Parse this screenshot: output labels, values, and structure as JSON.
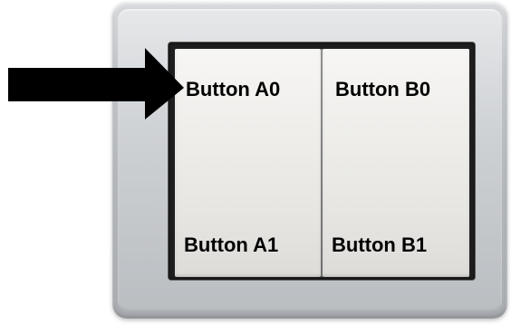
{
  "switch": {
    "buttons": [
      {
        "id": "A0",
        "label": "Button A0"
      },
      {
        "id": "B0",
        "label": "Button B0"
      },
      {
        "id": "A1",
        "label": "Button A1"
      },
      {
        "id": "B1",
        "label": "Button B1"
      }
    ]
  },
  "pointer": {
    "icon": "right-arrow-icon",
    "color": "#000000"
  },
  "colors": {
    "frame": "#b9bcc0",
    "rocker": "#efeeeb",
    "slot": "#1f1f1f"
  }
}
